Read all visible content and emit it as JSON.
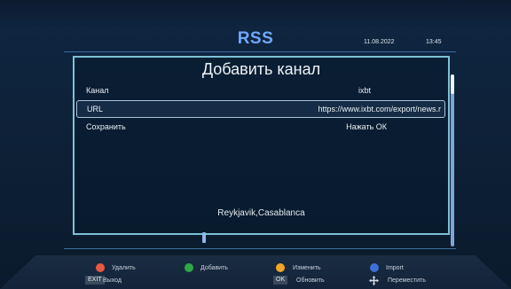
{
  "header": {
    "title": "RSS",
    "date": "11.08.2022",
    "time": "13:45"
  },
  "dialog": {
    "title": "Добавить канал",
    "rows": [
      {
        "label": "Канал",
        "value": "ixbt"
      },
      {
        "label": "URL",
        "value": "https://www.ixbt.com/export/news.r"
      },
      {
        "label": "Сохранить",
        "value": "Нажать ОК"
      }
    ],
    "location": "Reykjavik,Casablanca"
  },
  "footer": {
    "red_label": "Удалить",
    "green_label": "Добавить",
    "yellow_label": "Изменить",
    "blue_label": "Import",
    "exit_key": "EXIT",
    "exit_label": "Выход",
    "ok_key": "OK",
    "ok_label": "Обновить",
    "move_label": "Переместить"
  },
  "colors": {
    "title": "#6fa8ff",
    "red": "#e8583f",
    "green": "#2fa84a",
    "yellow": "#f2a623",
    "blue": "#3f6fd8"
  },
  "icons": {
    "move": "move-arrows-icon"
  }
}
